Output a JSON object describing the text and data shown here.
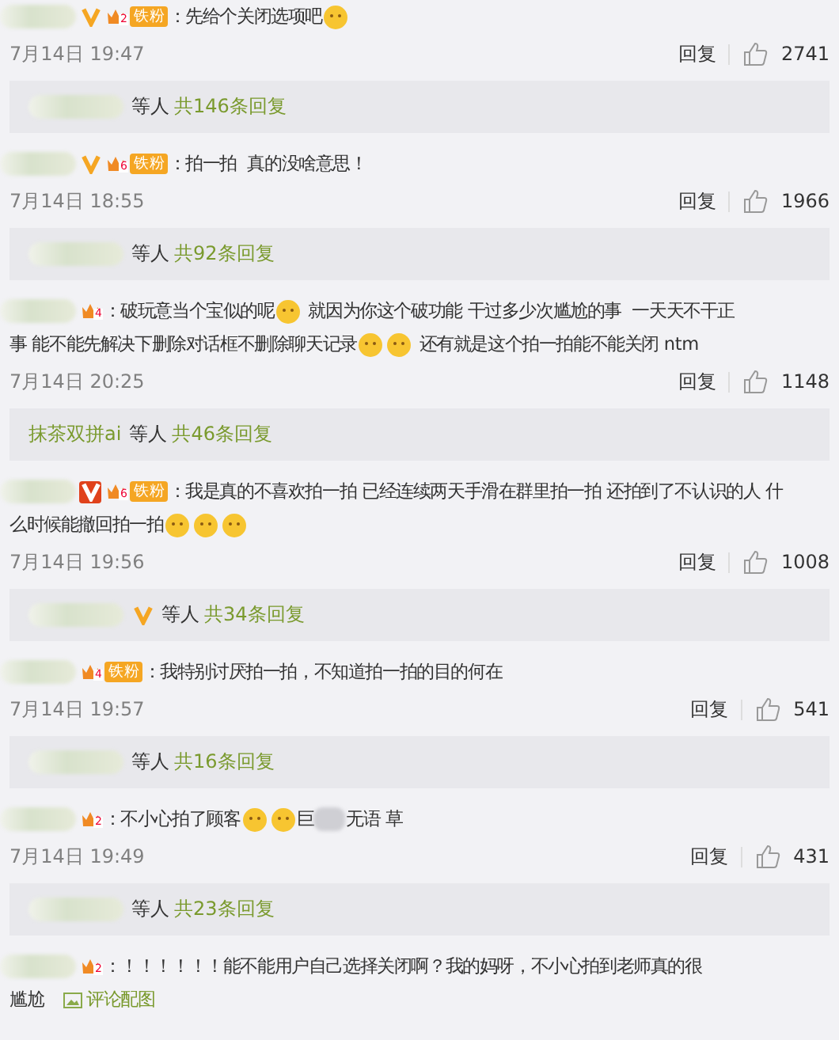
{
  "comments": [
    {
      "verified": true,
      "verified_boxed": false,
      "level": "2",
      "fan_badge": "铁粉",
      "lines": [
        [
          {
            "kind": "text",
            "text": "：先给个关闭选项吧"
          },
          {
            "kind": "emoji"
          }
        ]
      ],
      "date": "7月14日 19:47",
      "reply_label": "回复",
      "likes": "2741",
      "replies": {
        "others": "等人",
        "count": "共146条回复"
      }
    },
    {
      "verified": true,
      "verified_boxed": false,
      "level": "6",
      "fan_badge": "铁粉",
      "lines": [
        [
          {
            "kind": "text",
            "text": "：拍一拍  真的没啥意思！"
          }
        ]
      ],
      "date": "7月14日 18:55",
      "reply_label": "回复",
      "likes": "1966",
      "replies": {
        "others": "等人",
        "count": "共92条回复"
      }
    },
    {
      "level": "4",
      "lines": [
        [
          {
            "kind": "text",
            "text": "：破玩意当个宝似的呢"
          },
          {
            "kind": "emoji"
          },
          {
            "kind": "text",
            "text": " 就因为你这个破功能 干过多少次尴尬的事  一天天不干正"
          }
        ],
        [
          {
            "kind": "text",
            "text": "事 能不能先解决下删除对话框不删除聊天记录"
          },
          {
            "kind": "emoji"
          },
          {
            "kind": "emoji"
          },
          {
            "kind": "text",
            "text": " 还有就是这个拍一拍能不能关闭 ntm"
          }
        ]
      ],
      "date": "7月14日 20:25",
      "reply_label": "回复",
      "likes": "1148",
      "replies": {
        "lead_name": "抹茶双拼ai",
        "others": "等人",
        "count": "共46条回复"
      }
    },
    {
      "verified": true,
      "verified_boxed": true,
      "level": "6",
      "fan_badge": "铁粉",
      "lines": [
        [
          {
            "kind": "text",
            "text": "：我是真的不喜欢拍一拍 已经连续两天手滑在群里拍一拍 还拍到了不认识的人 什"
          }
        ],
        [
          {
            "kind": "text",
            "text": "么时候能撤回拍一拍"
          },
          {
            "kind": "emoji"
          },
          {
            "kind": "emoji"
          },
          {
            "kind": "emoji"
          }
        ]
      ],
      "date": "7月14日 19:56",
      "reply_label": "回复",
      "likes": "1008",
      "replies": {
        "verified": true,
        "others": "等人",
        "count": "共34条回复"
      }
    },
    {
      "level": "4",
      "fan_badge": "铁粉",
      "lines": [
        [
          {
            "kind": "text",
            "text": "：我特别讨厌拍一拍，不知道拍一拍的目的何在"
          }
        ]
      ],
      "date": "7月14日 19:57",
      "reply_label": "回复",
      "likes": "541",
      "replies": {
        "others": "等人",
        "count": "共16条回复"
      }
    },
    {
      "level": "2",
      "lines": [
        [
          {
            "kind": "text",
            "text": "：不小心拍了顾客"
          },
          {
            "kind": "emoji"
          },
          {
            "kind": "emoji"
          },
          {
            "kind": "text",
            "text": "巨"
          },
          {
            "kind": "blur"
          },
          {
            "kind": "text",
            "text": "无语 草"
          }
        ]
      ],
      "date": "7月14日 19:49",
      "reply_label": "回复",
      "likes": "431",
      "replies": {
        "others": "等人",
        "count": "共23条回复"
      }
    },
    {
      "level": "2",
      "lines": [
        [
          {
            "kind": "text",
            "text": "：！！！！！！能不能用户自己选择关闭啊？我的妈呀，不小心拍到老师真的很"
          }
        ],
        [
          {
            "kind": "text",
            "text": "尴尬"
          },
          {
            "kind": "image_link",
            "text": "评论配图"
          }
        ]
      ]
    }
  ]
}
